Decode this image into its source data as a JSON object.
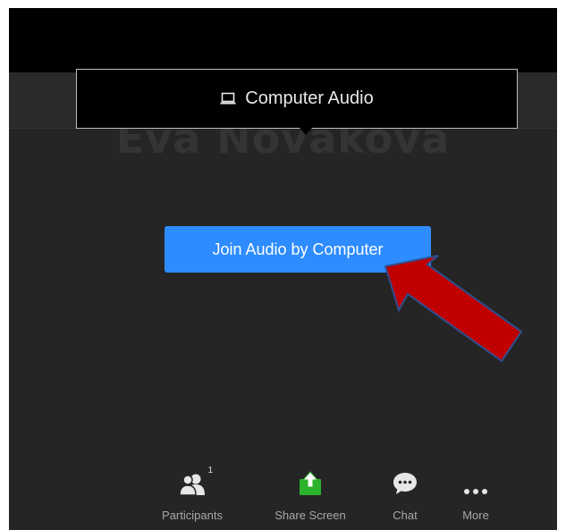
{
  "participant": {
    "name": "Eva Nováková"
  },
  "tooltip": {
    "label": "Computer Audio",
    "icon": "laptop-icon"
  },
  "join_button": {
    "label": "Join Audio by Computer"
  },
  "annotation": {
    "arrow_color": "#c00000",
    "arrow_outline": "#2f4f8f"
  },
  "toolbar": {
    "participants": {
      "label": "Participants",
      "count": "1",
      "icon": "participants-icon"
    },
    "share_screen": {
      "label": "Share Screen",
      "icon": "share-screen-icon",
      "color": "#2bb32b"
    },
    "chat": {
      "label": "Chat",
      "icon": "chat-icon"
    },
    "more": {
      "label": "More",
      "icon": "more-icon"
    }
  }
}
